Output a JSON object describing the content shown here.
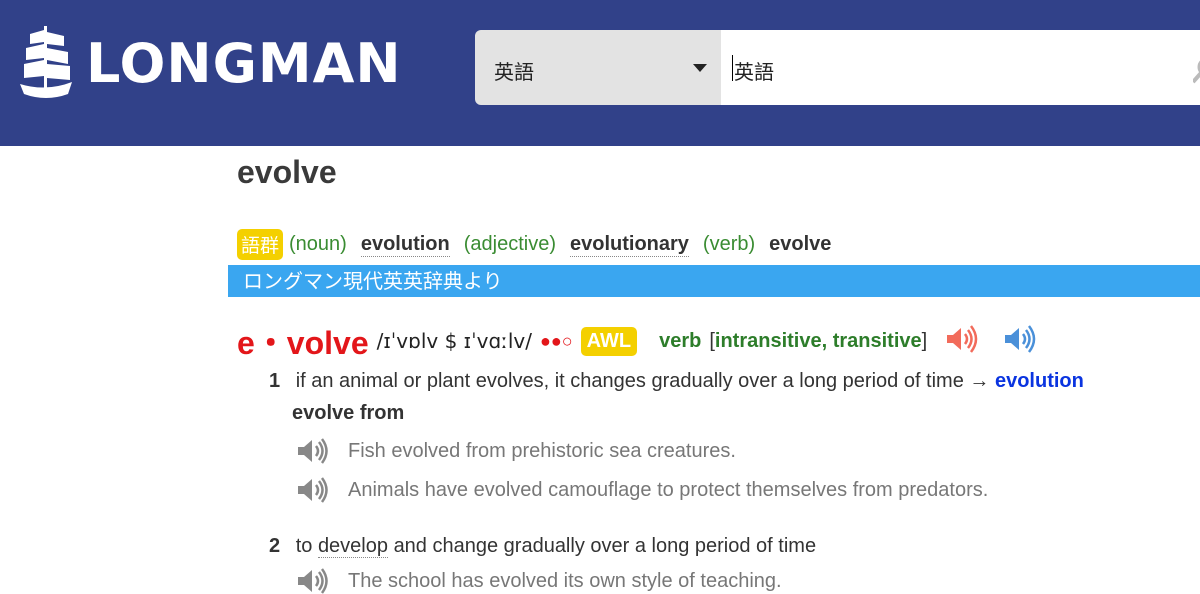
{
  "header": {
    "logo_text": "LONGMAN",
    "language_select": "英語",
    "search_value": "英語"
  },
  "headword": "evolve",
  "word_family": {
    "badge": "語群",
    "items": [
      {
        "pos": "(noun)",
        "word": "evolution"
      },
      {
        "pos": "(adjective)",
        "word": "evolutionary"
      },
      {
        "pos": "(verb)",
        "word": "evolve"
      }
    ]
  },
  "source_banner": "ロングマン現代英英辞典より",
  "entry": {
    "word": "e・volve",
    "pronunciation": "/ɪˈvɒlv $ ɪˈvɑːlv/",
    "frequency": "●●○",
    "awl": "AWL",
    "pos": "verb",
    "grammar_open": "[",
    "grammar": "intransitive, transitive",
    "grammar_close": "]",
    "audio_british_color": "#f26b5b",
    "audio_american_color": "#4a90d9"
  },
  "senses": [
    {
      "number": "1",
      "definition": "if an animal or plant evolves, it changes gradually over a long period of time",
      "arrow": "→",
      "crossref": "evolution",
      "collocation": "evolve from",
      "examples": [
        "Fish evolved from prehistoric sea creatures.",
        "Animals have evolved camouflage to protect themselves from predators."
      ]
    },
    {
      "number": "2",
      "definition_pre": "to",
      "definition_link": "develop",
      "definition_post": "and change gradually over a long period of time",
      "examples": [
        "The school has evolved its own style of teaching."
      ]
    }
  ]
}
